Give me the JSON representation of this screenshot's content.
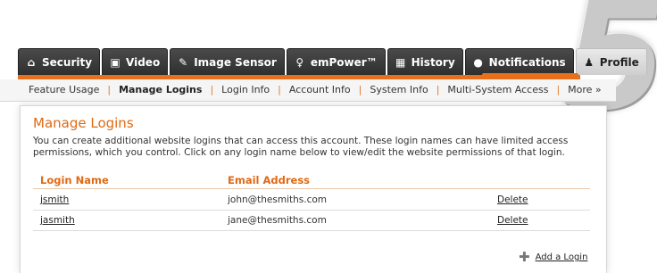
{
  "big_number": "5",
  "tabs": [
    {
      "label": "Security",
      "icon": "home-icon"
    },
    {
      "label": "Video",
      "icon": "video-icon"
    },
    {
      "label": "Image Sensor",
      "icon": "image-sensor-icon"
    },
    {
      "label": "emPower™",
      "icon": "bulb-icon"
    },
    {
      "label": "History",
      "icon": "calendar-icon"
    },
    {
      "label": "Notifications",
      "icon": "chat-bubble-icon"
    },
    {
      "label": "Profile",
      "icon": "person-icon"
    }
  ],
  "subnav": {
    "items": [
      "Feature Usage",
      "Manage Logins",
      "Login Info",
      "Account Info",
      "System Info",
      "Multi-System Access",
      "More »"
    ]
  },
  "panel": {
    "title": "Manage Logins",
    "description": "You can create additional website logins that can access this account. These login names can have limited access permissions, which you control. Click on any login name below to view/edit the website permissions of that login.",
    "columns": [
      "Login Name",
      "Email Address"
    ],
    "rows": [
      {
        "login": "jsmith",
        "email": "john@thesmiths.com",
        "action": "Delete"
      },
      {
        "login": "jasmith",
        "email": "jane@thesmiths.com",
        "action": "Delete"
      }
    ],
    "add_label": "Add a Login"
  },
  "colors": {
    "accent": "#e86f1b",
    "tab_dark": "#333333"
  }
}
